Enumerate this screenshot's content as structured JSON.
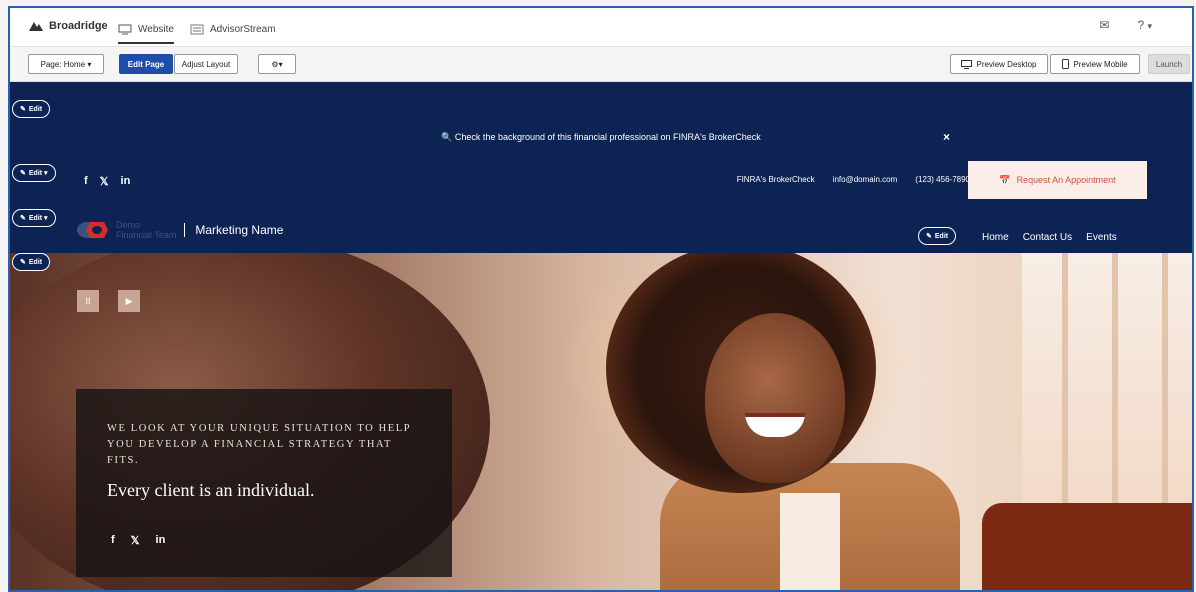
{
  "appbar": {
    "brand": "Broadridge",
    "tabs": [
      {
        "label": "Website",
        "icon": "monitor-icon"
      },
      {
        "label": "AdvisorStream",
        "icon": "newspaper-icon"
      }
    ],
    "mail_icon": "✉",
    "help_label": "?",
    "help_caret": "▾"
  },
  "toolbar": {
    "page_select": "Page: Home ▾",
    "edit_page": "Edit Page",
    "adjust_layout": "Adjust Layout",
    "settings": "⚙▾",
    "preview_desktop": "Preview Desktop",
    "preview_mobile": "Preview Mobile",
    "launch": "Launch"
  },
  "edit_controls": {
    "edit": "Edit",
    "edit_dropdown": "Edit ▾"
  },
  "site": {
    "notice": "Check the background of this financial professional on FINRA's BrokerCheck",
    "notice_close": "×",
    "social": [
      "f",
      "🐦",
      "in"
    ],
    "contact": {
      "brokercheck": "FINRA's BrokerCheck",
      "email": "info@domain.com",
      "phone": "(123) 456-7890"
    },
    "appointment": "Request An Appointment",
    "brand_demo": [
      "Demo",
      "Financial Team"
    ],
    "marketing_name": "Marketing Name",
    "nav": [
      "Home",
      "Contact Us",
      "Events"
    ]
  },
  "hero": {
    "pause": "II",
    "play": "▶",
    "kicker": "We look at your unique situation to help you develop a financial strategy that fits.",
    "headline": "Every client is an individual.",
    "social": [
      "f",
      "🐦",
      "in"
    ]
  },
  "colors": {
    "navy": "#0c2354",
    "primary_button": "#1f4ea8",
    "appointment_bg": "#fbeee8",
    "appointment_text": "#c8533b",
    "logo_red": "#d1302b"
  }
}
